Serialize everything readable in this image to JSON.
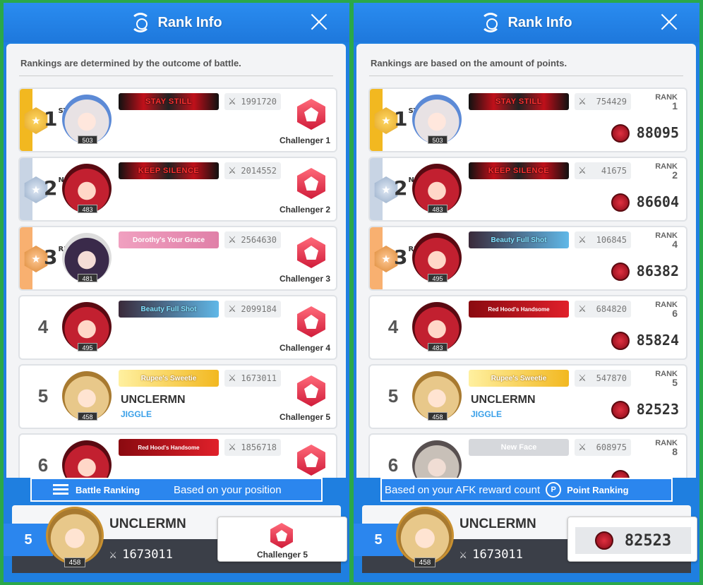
{
  "left": {
    "header": {
      "title": "Rank Info"
    },
    "description": "Rankings are determined by the outcome of battle.",
    "rows": [
      {
        "rank": "1",
        "suffix": "ST",
        "level": "503",
        "banner": "STAY  STILL",
        "power": "1991720",
        "challenger": "Challenger 1",
        "name": "",
        "guild": ""
      },
      {
        "rank": "2",
        "suffix": "ND",
        "level": "483",
        "banner": "KEEP  SILENCE",
        "power": "2014552",
        "challenger": "Challenger 2",
        "name": "",
        "guild": ""
      },
      {
        "rank": "3",
        "suffix": "RD",
        "level": "481",
        "banner": "Dorothy's Your Grace",
        "power": "2564630",
        "challenger": "Challenger 3",
        "name": "",
        "guild": ""
      },
      {
        "rank": "4",
        "suffix": "",
        "level": "495",
        "banner": "Beauty Full Shot",
        "power": "2099184",
        "challenger": "Challenger 4",
        "name": "",
        "guild": ""
      },
      {
        "rank": "5",
        "suffix": "",
        "level": "458",
        "banner": "Rupee's Sweetie",
        "power": "1673011",
        "challenger": "Challenger 5",
        "name": "UNCLERMN",
        "guild": "JIGGLE"
      },
      {
        "rank": "6",
        "suffix": "",
        "level": "",
        "banner": "Red Hood's Handsome",
        "power": "1856718",
        "challenger": "",
        "name": "",
        "guild": ""
      }
    ],
    "tab": {
      "label": "Battle Ranking",
      "note": "Based on your position"
    },
    "me": {
      "rank": "5",
      "level": "458",
      "name": "UNCLERMN",
      "power": "1673011",
      "challenger": "Challenger 5"
    }
  },
  "right": {
    "header": {
      "title": "Rank Info"
    },
    "description": "Rankings are based on the amount of points.",
    "rank_label": "RANK",
    "rows": [
      {
        "rank": "1",
        "suffix": "ST",
        "level": "503",
        "banner": "STAY  STILL",
        "power": "754429",
        "prev_rank": "1",
        "points": "88095",
        "name": "",
        "guild": ""
      },
      {
        "rank": "2",
        "suffix": "ND",
        "level": "483",
        "banner": "KEEP  SILENCE",
        "power": "41675",
        "prev_rank": "2",
        "points": "86604",
        "name": "",
        "guild": ""
      },
      {
        "rank": "3",
        "suffix": "RD",
        "level": "495",
        "banner": "Beauty Full Shot",
        "power": "106845",
        "prev_rank": "4",
        "points": "86382",
        "name": "",
        "guild": ""
      },
      {
        "rank": "4",
        "suffix": "",
        "level": "483",
        "banner": "Red Hood's Handsome",
        "power": "684820",
        "prev_rank": "6",
        "points": "85824",
        "name": "",
        "guild": ""
      },
      {
        "rank": "5",
        "suffix": "",
        "level": "458",
        "banner": "Rupee's Sweetie",
        "power": "547870",
        "prev_rank": "5",
        "points": "82523",
        "name": "UNCLERMN",
        "guild": "JIGGLE"
      },
      {
        "rank": "6",
        "suffix": "",
        "level": "",
        "banner": "New Face",
        "power": "608975",
        "prev_rank": "8",
        "points": "",
        "name": "",
        "guild": ""
      }
    ],
    "tab": {
      "note": "Based on your AFK reward count",
      "label": "Point Ranking",
      "icon_letter": "P"
    },
    "me": {
      "rank": "5",
      "level": "458",
      "name": "UNCLERMN",
      "power": "1673011",
      "points": "82523"
    }
  },
  "icons": {
    "power": "crossed-swords-icon",
    "close": "close-icon",
    "points": "point-coin-icon",
    "challenger": "challenger-gem-icon"
  },
  "colors": {
    "accent": "#2b86ee",
    "gold": "#f2b820",
    "silver": "#8ea6c4",
    "bronze": "#d8822c",
    "guild": "#3aa0e8"
  }
}
